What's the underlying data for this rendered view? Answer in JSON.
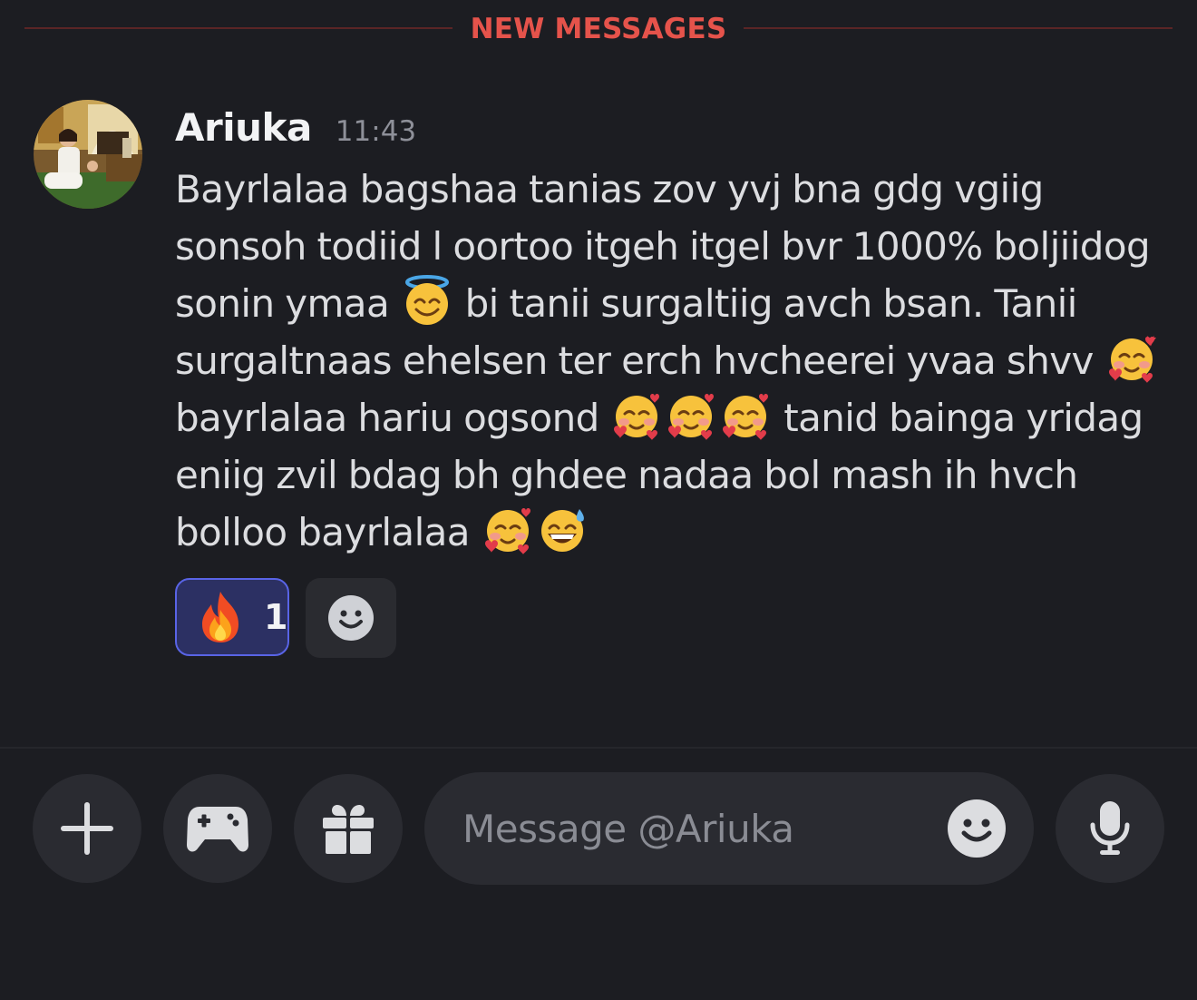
{
  "divider": {
    "label": "NEW MESSAGES"
  },
  "message": {
    "author": "Ariuka",
    "timestamp": "11:43",
    "segments": [
      "Bayrlalaa bagshaa tanias zov yvj bna gdg vgiig sonsoh todiid l oortoo itgeh itgel bvr 1000% boljiidog sonin ymaa ",
      " bi tanii surgaltiig avch bsan. Tanii surgaltnaas ehelsen ter erch hvcheerei yvaa shvv ",
      " bayrlalaa hariu ogsond ",
      " tanid bainga yridag eniig zvil bdag bh ghdee nadaa bol mash ih hvch bolloo bayrlalaa "
    ],
    "inline_emojis": [
      "smiling-face-with-halo",
      "smiling-face-with-hearts",
      "smiling-face-with-hearts-x3",
      "smiling-face-with-hearts",
      "grinning-face-with-sweat"
    ]
  },
  "reactions": [
    {
      "emoji": "fire",
      "count": "1",
      "selected": true
    }
  ],
  "composer": {
    "placeholder": "Message @Ariuka"
  },
  "colors": {
    "background": "#1c1d22",
    "divider_accent": "#e5534b",
    "reaction_border": "#5964e6",
    "reaction_fill": "#2c3063"
  }
}
